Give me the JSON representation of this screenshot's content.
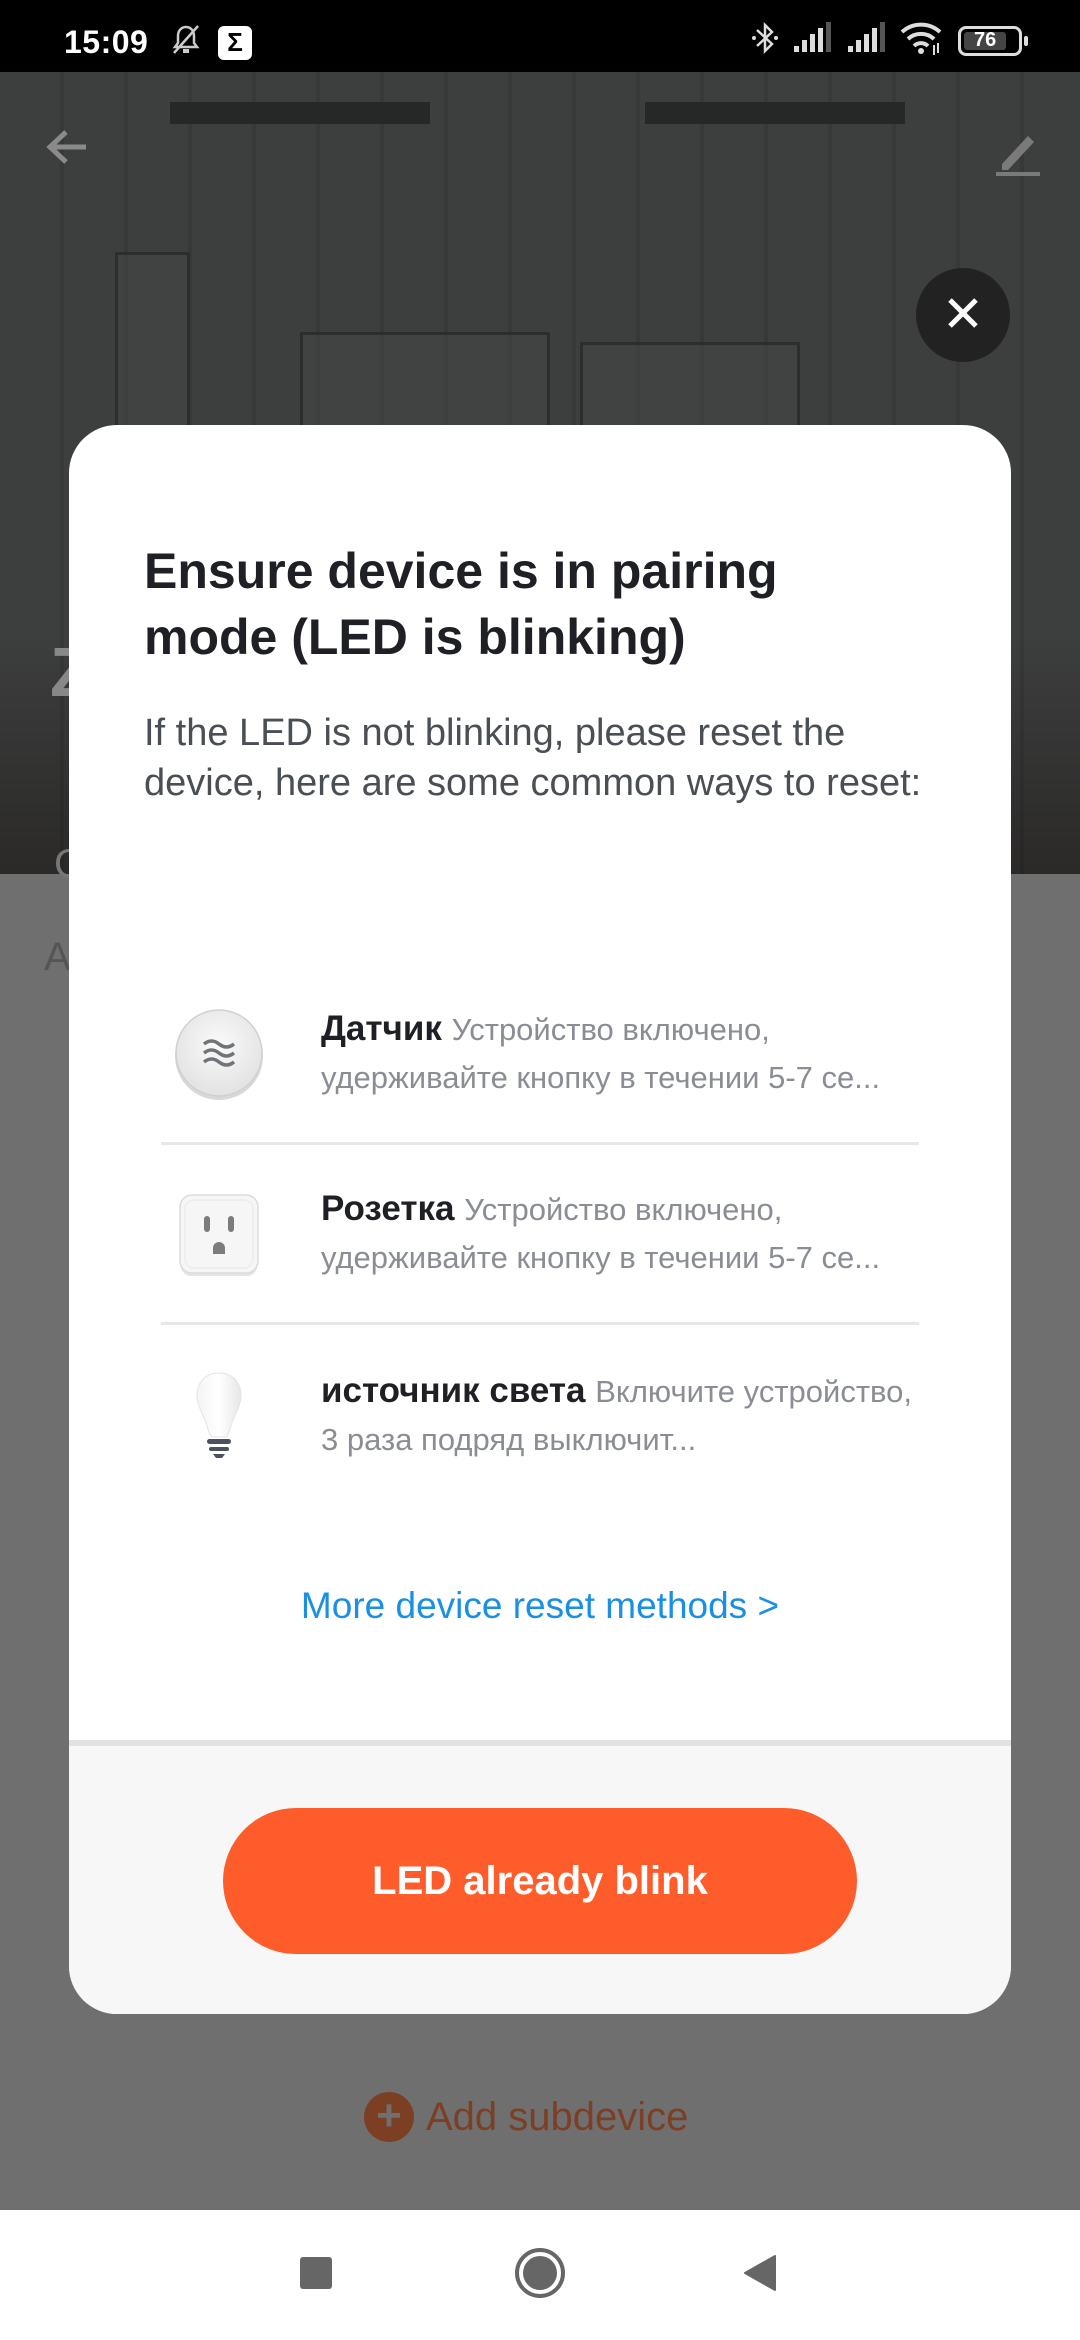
{
  "status_bar": {
    "time": "15:09",
    "left_icons": [
      "muted-alarm-icon",
      "sigma-app-icon"
    ],
    "sigma_glyph": "Σ",
    "right_icons": [
      "bluetooth-icon",
      "signal-icon",
      "signal-icon",
      "wifi-icon",
      "battery-icon"
    ],
    "battery_percent": "76"
  },
  "background_page": {
    "back_label": "Back",
    "edit_label": "Edit",
    "title_initial": "Z",
    "subtitle_initial": "C",
    "section_initial": "A",
    "add_subdevice_label": "Add subdevice",
    "accent_color": "#7d3f24"
  },
  "modal": {
    "close_label": "Close",
    "title": "Ensure device is in pairing mode (LED is blinking)",
    "description": "If the LED is not blinking, please reset the device, here are some common ways to reset:",
    "reset_methods": [
      {
        "icon": "sensor-icon",
        "name": "Датчик",
        "instructions": "Устройство включено, удерживайте кнопку в течении 5-7 се..."
      },
      {
        "icon": "socket-icon",
        "name": "Розетка",
        "instructions": "Устройство включено, удерживайте кнопку в течении 5-7 се..."
      },
      {
        "icon": "light-bulb-icon",
        "name": "источник света",
        "instructions": "Включите устройство, 3 раза подряд выключит..."
      }
    ],
    "more_link": "More device reset methods >",
    "primary_button": "LED already blink",
    "primary_color": "#ff5c2b",
    "link_color": "#1a8fe3"
  },
  "nav_bar": {
    "recents_label": "Recents",
    "home_label": "Home",
    "back_label": "Back"
  }
}
